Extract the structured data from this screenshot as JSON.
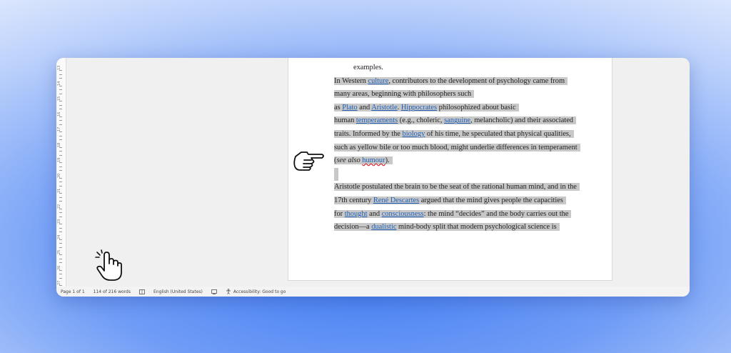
{
  "document": {
    "lines": [
      {
        "segments": [
          {
            "t": "examples."
          }
        ],
        "selected": false,
        "indent": true
      },
      {
        "segments": [
          {
            "t": "In Western "
          },
          {
            "t": "culture",
            "link": true
          },
          {
            "t": ", contributors to the development of psychology came from"
          }
        ],
        "selected": true
      },
      {
        "segments": [
          {
            "t": "many areas, beginning with philosophers such"
          }
        ],
        "selected": true
      },
      {
        "segments": [
          {
            "t": "as "
          },
          {
            "t": "Plato",
            "link": true
          },
          {
            "t": " and "
          },
          {
            "t": "Aristotle",
            "link": true
          },
          {
            "t": ". "
          },
          {
            "t": "Hippocrates",
            "link": true
          },
          {
            "t": " philosophized about basic"
          }
        ],
        "selected": true
      },
      {
        "segments": [
          {
            "t": "human "
          },
          {
            "t": "temperaments",
            "link": true
          },
          {
            "t": " (e.g., choleric, "
          },
          {
            "t": "sanguine",
            "link": true
          },
          {
            "t": ", melancholic) and their associated"
          }
        ],
        "selected": true
      },
      {
        "segments": [
          {
            "t": "traits. Informed by the "
          },
          {
            "t": "biology",
            "link": true
          },
          {
            "t": " of his time, he speculated that physical qualities,"
          }
        ],
        "selected": true
      },
      {
        "segments": [
          {
            "t": "such as yellow bile or too much blood, might underlie differences in temperament"
          }
        ],
        "selected": true
      },
      {
        "segments": [
          {
            "t": "("
          },
          {
            "t": "see also",
            "italic": true
          },
          {
            "t": " "
          },
          {
            "t": "humour",
            "link": true,
            "spell": true
          },
          {
            "t": ")."
          }
        ],
        "selected": true
      },
      {
        "gap": true
      },
      {
        "segments": [
          {
            "t": "Aristotle postulated the brain to be the seat of the rational human mind, and in the"
          }
        ],
        "selected": true
      },
      {
        "segments": [
          {
            "t": "17th century "
          },
          {
            "t": "René Descartes",
            "link": true
          },
          {
            "t": " argued that the mind gives people the capacities"
          }
        ],
        "selected": true
      },
      {
        "segments": [
          {
            "t": "for "
          },
          {
            "t": "thought",
            "link": true
          },
          {
            "t": " and "
          },
          {
            "t": "consciousness",
            "link": true
          },
          {
            "t": ": the mind “decides” and the body carries out the"
          }
        ],
        "selected": true
      },
      {
        "segments": [
          {
            "t": "decision—a "
          },
          {
            "t": "dualistic",
            "link": true
          },
          {
            "t": " mind-body split that modern psychological science is"
          }
        ],
        "selected": true
      }
    ]
  },
  "ruler": {
    "labels": [
      "13",
      "14",
      "15",
      "16",
      "17",
      "18",
      "19",
      "20",
      "21",
      "22",
      "23",
      "24",
      "25",
      "26",
      "27"
    ]
  },
  "statusbar": {
    "page": "Page 1 of 1",
    "words": "114 of 216 words",
    "language": "English (United States)",
    "accessibility": "Accessibility: Good to go"
  },
  "icons": {
    "proofing": "book-check-icon",
    "focus": "display-settings-icon",
    "accessibility": "accessibility-icon",
    "pointing_hand": "hand-pointing-right-icon",
    "click_hand": "hand-click-icon"
  },
  "colors": {
    "selection": "#c8c8c8",
    "link": "#1f5fb8"
  }
}
